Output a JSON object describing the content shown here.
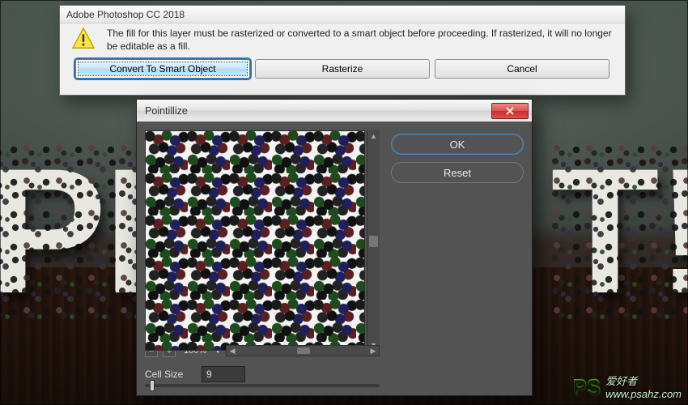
{
  "msgbox": {
    "title": "Adobe Photoshop CC 2018",
    "message": "The fill for this layer must be rasterized or converted to a smart object before proceeding. If rasterized, it will no longer be editable as a fill.",
    "buttons": {
      "convert": "Convert To Smart Object",
      "rasterize": "Rasterize",
      "cancel": "Cancel"
    }
  },
  "filter": {
    "title": "Pointillize",
    "ok": "OK",
    "reset": "Reset",
    "zoom": "100%",
    "cell_size_label": "Cell Size",
    "cell_size_value": "9"
  },
  "background_text": {
    "left": "PI",
    "right": "T!"
  },
  "watermark": {
    "logo": "PS",
    "label": "爱好者",
    "url": "www.psahz.com"
  }
}
